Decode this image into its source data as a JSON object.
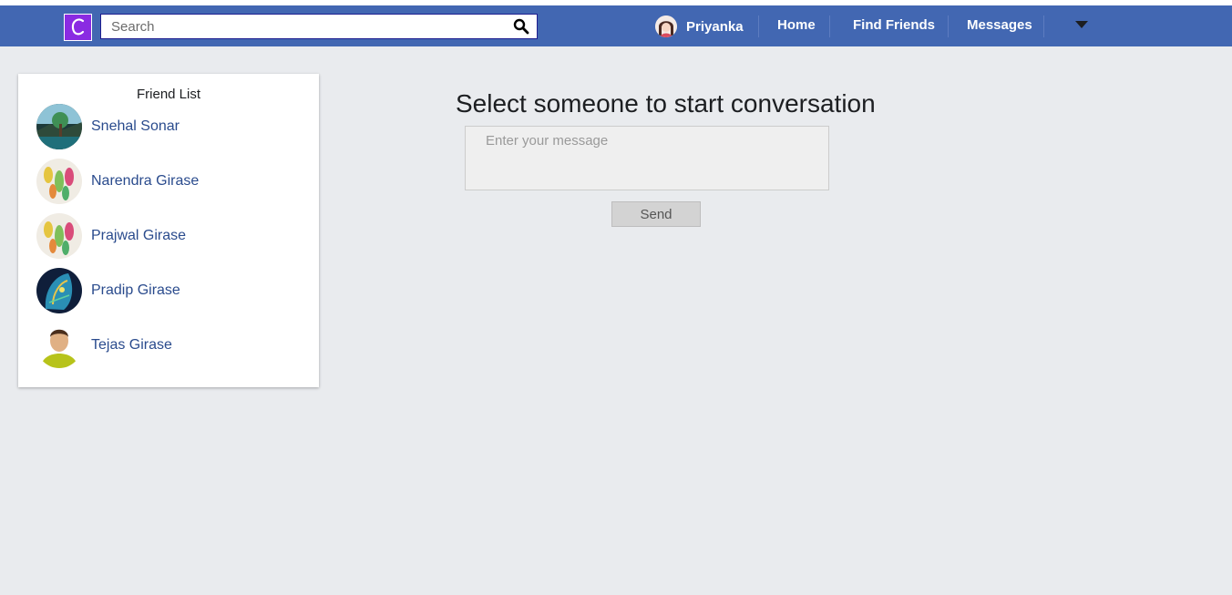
{
  "navbar": {
    "logo_letter": "C",
    "search_placeholder": "Search",
    "user_name": "Priyanka",
    "links": [
      "Home",
      "Find Friends",
      "Messages"
    ],
    "bg_color": "#4267b2"
  },
  "friends": {
    "title": "Friend List",
    "items": [
      {
        "name": "Snehal Sonar",
        "avatar": "landscape-photo"
      },
      {
        "name": "Narendra Girase",
        "avatar": "flowers-photo"
      },
      {
        "name": "Prajwal Girase",
        "avatar": "flowers-photo"
      },
      {
        "name": "Pradip Girase",
        "avatar": "abstract-art-photo"
      },
      {
        "name": "Tejas Girase",
        "avatar": "default-user-avatar"
      }
    ]
  },
  "chat": {
    "heading": "Select someone to start conversation",
    "message_placeholder": "Enter your message",
    "send_label": "Send"
  }
}
